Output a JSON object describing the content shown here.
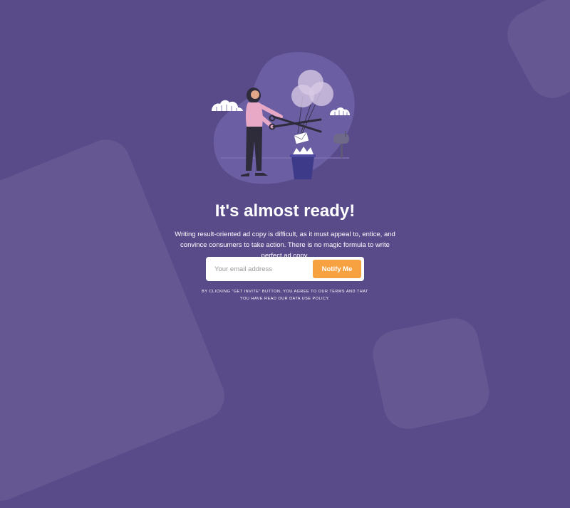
{
  "hero": {
    "title": "It's almost ready!",
    "description": "Writing result-oriented ad copy is difficult, as it must appeal to, entice, and convince consumers to take action. There is no magic formula to write perfect ad copy."
  },
  "signup": {
    "email_placeholder": "Your email address",
    "email_value": "",
    "notify_label": "Notify Me"
  },
  "disclaimer": "By clicking \"Get Invite\" button, you agree to our terms and that you have read our data use policy.",
  "colors": {
    "background": "#594b8a",
    "accent": "#f7a241",
    "blob": "#6b5ea3"
  },
  "illustration": {
    "icon": "woman-cutting-balloon-strings-illustration"
  }
}
